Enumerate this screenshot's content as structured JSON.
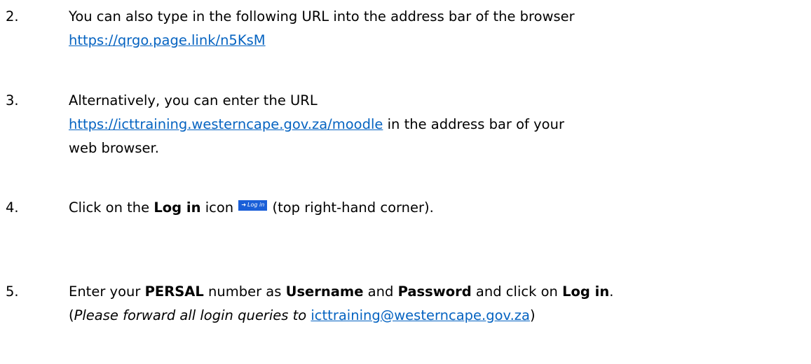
{
  "steps": [
    {
      "number": "2.",
      "line1": "You can also type in the following URL into the address bar of the browser",
      "link": "https://qrgo.page.link/n5KsM"
    },
    {
      "number": "3.",
      "line1": "Alternatively, you can enter the URL",
      "link": "https://icttraining.westerncape.gov.za/moodle",
      "after_link": " in the address bar of your",
      "line3": "web browser."
    },
    {
      "number": "4.",
      "text_before": "Click on the ",
      "bold": "Log in",
      "text_mid": " icon ",
      "icon_label": "Log in",
      "text_after": " (top right-hand corner)."
    },
    {
      "number": "5.",
      "t1": "Enter your ",
      "b1": "PERSAL",
      "t2": " number as ",
      "b2": "Username",
      "t3": " and ",
      "b3": "Password",
      "t4": " and click on ",
      "b4": "Log in",
      "t5": ".",
      "paren_open": "(",
      "italic": "Please forward all login queries to",
      "space": " ",
      "email": "icttraining@westerncape.gov.za",
      "paren_close": ")"
    }
  ],
  "icons": {
    "login": "login-arrow-icon"
  },
  "colors": {
    "link": "#0563c1",
    "login_button": "#1a5fd8"
  }
}
